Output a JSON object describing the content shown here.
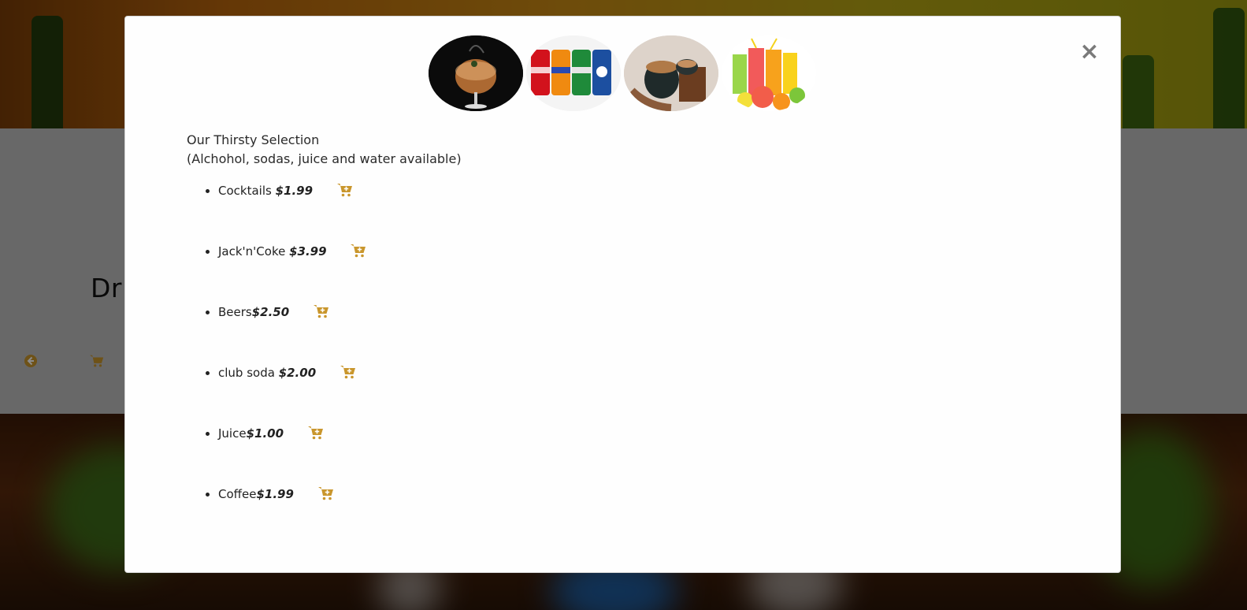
{
  "page": {
    "title": "Dri",
    "icons": {
      "back": "arrow-left-circle-icon",
      "cart": "shopping-cart-icon"
    }
  },
  "modal": {
    "close_label": "×",
    "thumbnails": [
      {
        "name": "cocktail-photo"
      },
      {
        "name": "soda-cans-photo"
      },
      {
        "name": "coffee-photo"
      },
      {
        "name": "juice-photo"
      }
    ],
    "heading": "Our Thirsty Selection",
    "subheading": "(Alchohol, sodas, juice and water available)",
    "items": [
      {
        "name": "Cocktails ",
        "price": "$1.99"
      },
      {
        "name": "Jack'n'Coke ",
        "price": "$3.99"
      },
      {
        "name": "Beers",
        "price": "$2.50"
      },
      {
        "name": "club soda ",
        "price": "$2.00"
      },
      {
        "name": "Juice",
        "price": "$1.00"
      },
      {
        "name": "Coffee",
        "price": "$1.99"
      }
    ],
    "cart_icon": "add-to-cart-icon"
  },
  "colors": {
    "accent": "#c9962c",
    "close": "#7a7a7a"
  }
}
